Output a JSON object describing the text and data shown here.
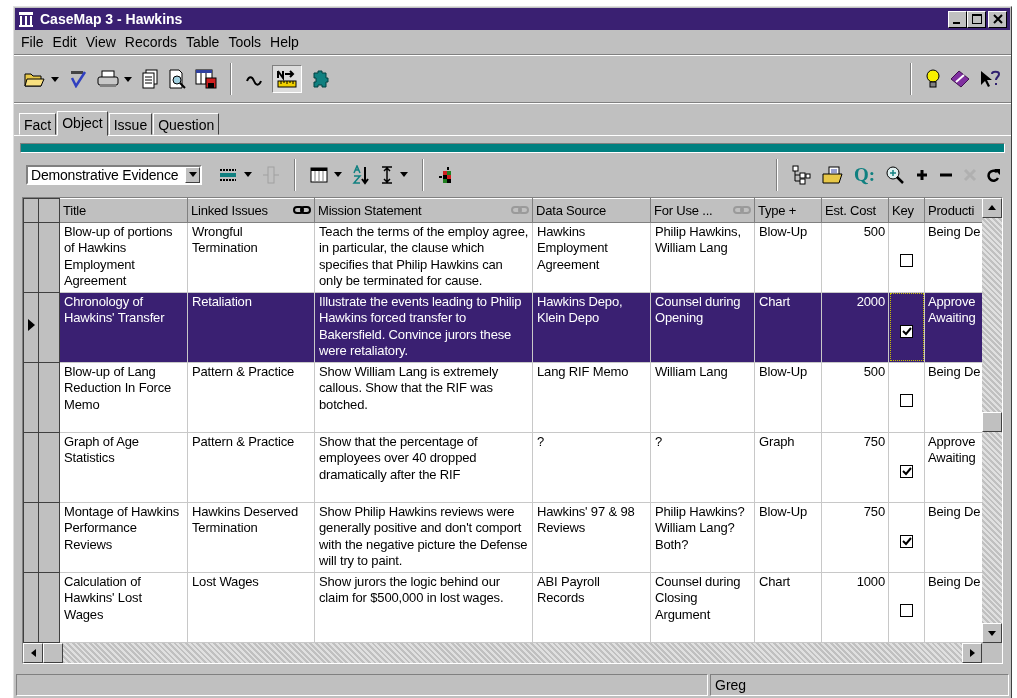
{
  "window": {
    "title": "CaseMap 3 - Hawkins"
  },
  "menu": [
    "File",
    "Edit",
    "View",
    "Records",
    "Table",
    "Tools",
    "Help"
  ],
  "tabs": [
    {
      "label": "Fact",
      "selected": false
    },
    {
      "label": "Object",
      "selected": true
    },
    {
      "label": "Issue",
      "selected": false
    },
    {
      "label": "Question",
      "selected": false
    }
  ],
  "view_selector": {
    "value": "Demonstrative Evidence"
  },
  "query_button": "Q:",
  "table": {
    "columns": [
      {
        "label": "Title",
        "kind": "plain"
      },
      {
        "label": "Linked Issues",
        "kind": "link"
      },
      {
        "label": "Mission Statement",
        "kind": "link-off"
      },
      {
        "label": "Data Source",
        "kind": "plain"
      },
      {
        "label": "For Use ...",
        "kind": "link-off"
      },
      {
        "label": "Type +",
        "kind": "plain"
      },
      {
        "label": "Est. Cost",
        "kind": "plain"
      },
      {
        "label": "Key",
        "kind": "plain"
      },
      {
        "label": "Producti",
        "kind": "plain"
      }
    ],
    "rows": [
      {
        "selected": false,
        "title": "Blow-up of portions of Hawkins Employment Agreement",
        "linked_issues": "Wrongful Termination",
        "mission": "Teach the terms of the employ agree, in particular, the clause which specifies that Philip Hawkins can only be terminated for cause.",
        "data_source": "Hawkins Employment Agreement",
        "for_use": "Philip Hawkins, William Lang",
        "type": "Blow-Up",
        "est_cost": "500",
        "key": false,
        "production": [
          "Being De"
        ]
      },
      {
        "selected": true,
        "title": "Chronology of Hawkins' Transfer",
        "linked_issues": "Retaliation",
        "mission": "Illustrate the events leading to Philip Hawkins forced transfer to Bakersfield.  Convince jurors these were retaliatory.",
        "data_source": "Hawkins Depo, Klein Depo",
        "for_use": "Counsel during Opening",
        "type": "Chart",
        "est_cost": "2000",
        "key": true,
        "production": [
          "Approve",
          "Awaiting"
        ]
      },
      {
        "selected": false,
        "title": "Blow-up of Lang Reduction In Force Memo",
        "linked_issues": "Pattern & Practice",
        "mission": "Show William Lang is extremely callous.  Show that the RIF was botched.",
        "data_source": "Lang RIF Memo",
        "for_use": "William Lang",
        "type": "Blow-Up",
        "est_cost": "500",
        "key": false,
        "production": [
          "Being De"
        ]
      },
      {
        "selected": false,
        "title": "Graph of Age Statistics",
        "linked_issues": "Pattern & Practice",
        "mission": "Show that the percentage of employees over 40 dropped dramatically after the RIF",
        "data_source": "?",
        "for_use": "?",
        "type": "Graph",
        "est_cost": "750",
        "key": true,
        "production": [
          "Approve",
          "Awaiting"
        ]
      },
      {
        "selected": false,
        "title": "Montage of Hawkins Performance Reviews",
        "linked_issues": "Hawkins Deserved Termination",
        "mission": "Show Philip Hawkins reviews were generally positive and don't comport with the negative picture the Defense will try to paint.",
        "data_source": "Hawkins' 97 & 98 Reviews",
        "for_use": "Philip Hawkins? William Lang? Both?",
        "type": "Blow-Up",
        "est_cost": "750",
        "key": true,
        "production": [
          "Being De"
        ]
      },
      {
        "selected": false,
        "title": "Calculation of Hawkins' Lost Wages",
        "linked_issues": "Lost Wages",
        "mission": "Show jurors the logic behind our claim for $500,000 in lost wages.",
        "data_source": "ABI Payroll Records",
        "for_use": "Counsel during Closing Argument",
        "type": "Chart",
        "est_cost": "1000",
        "key": false,
        "production": [
          "Being De"
        ]
      }
    ]
  },
  "status_bar": {
    "user": "Greg"
  }
}
